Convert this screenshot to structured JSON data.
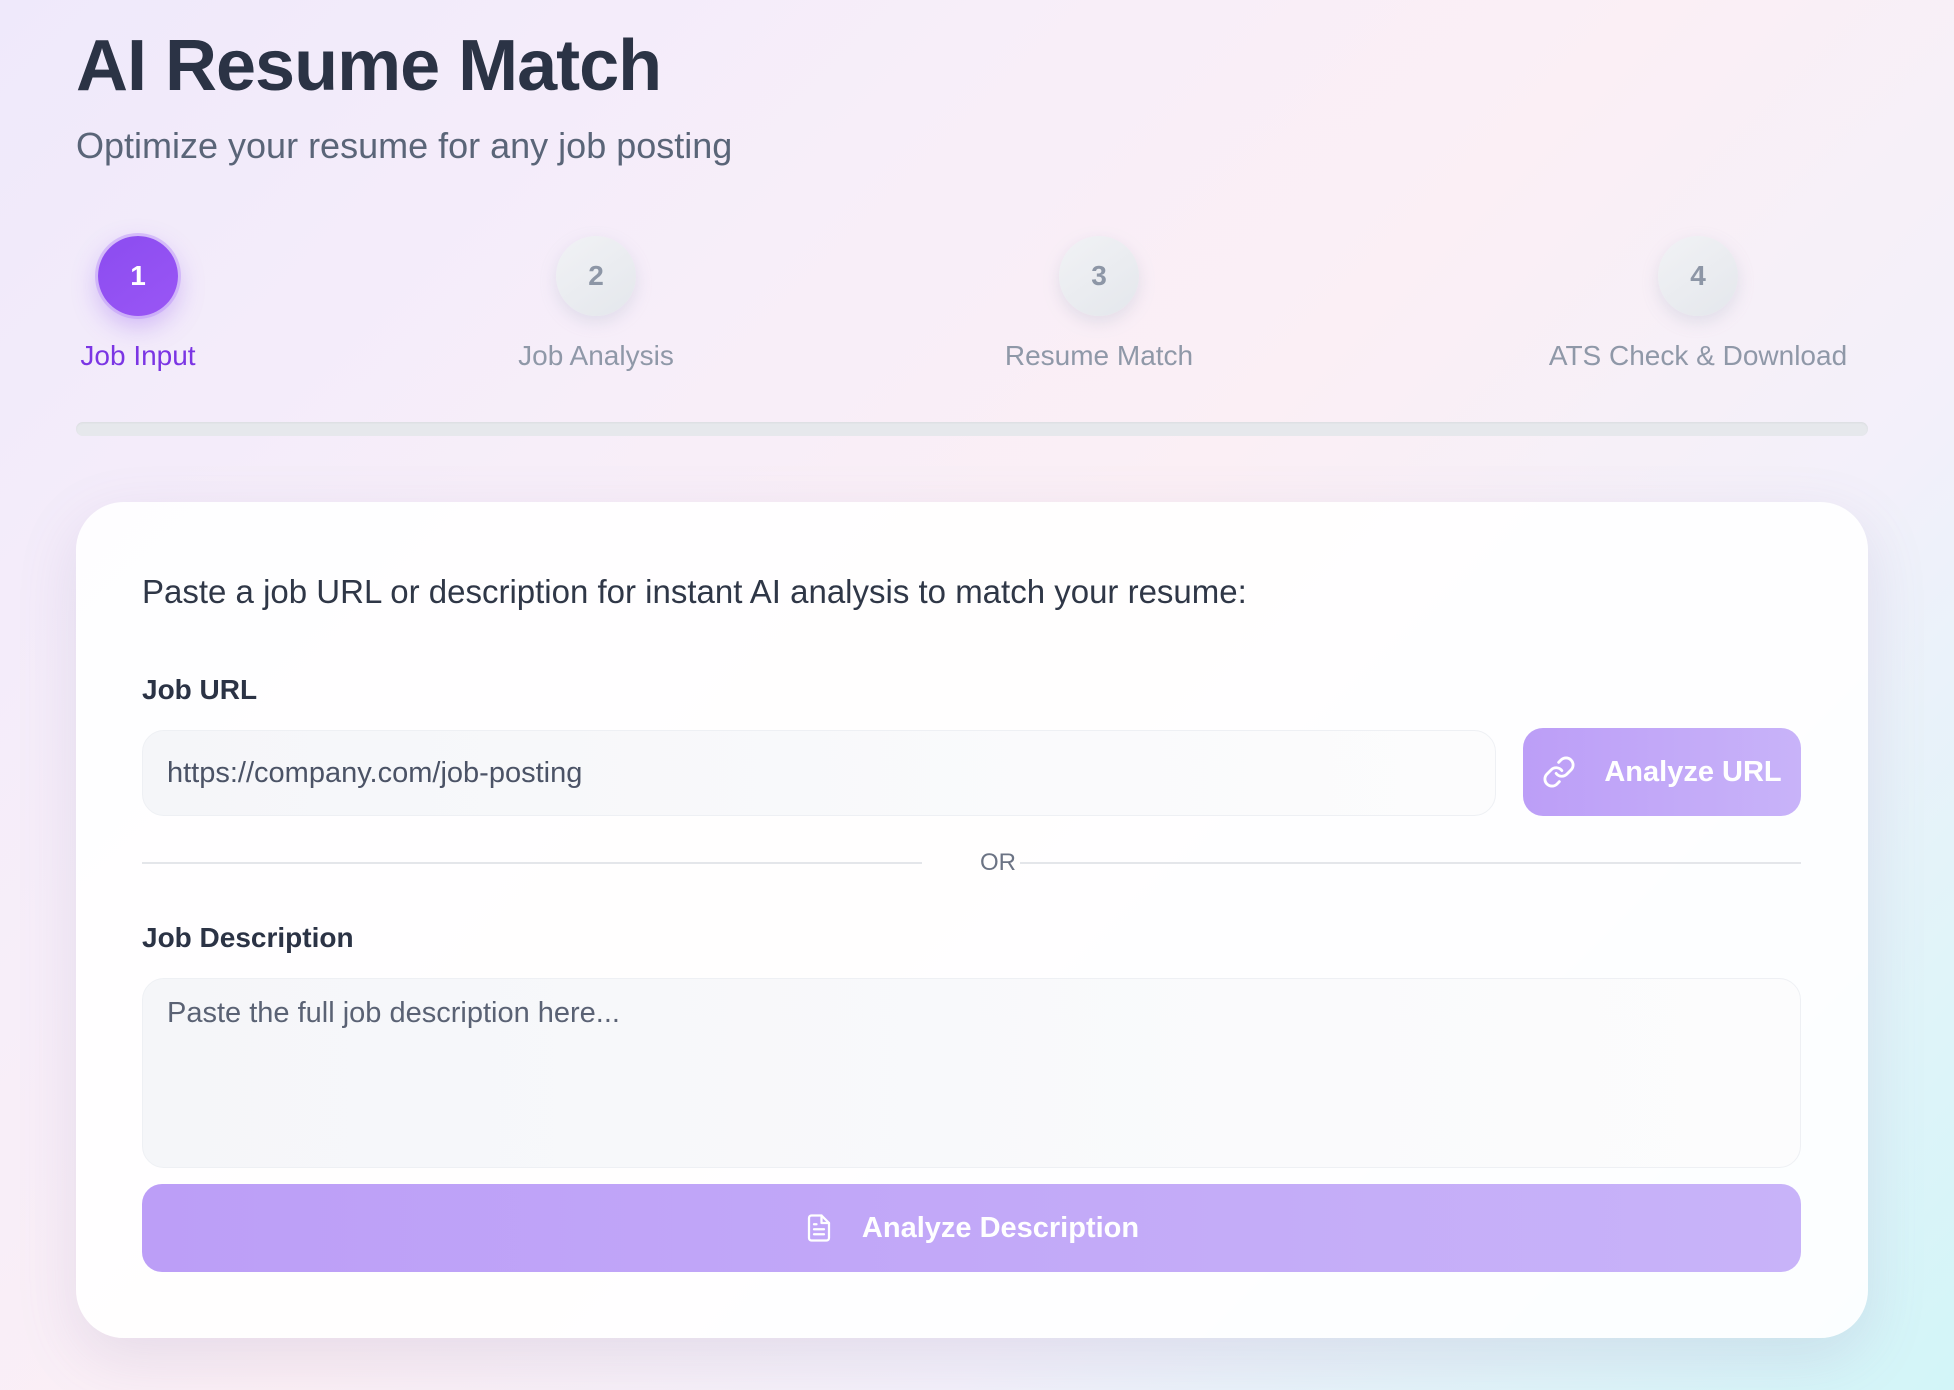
{
  "header": {
    "title": "AI Resume Match",
    "subtitle": "Optimize your resume for any job posting"
  },
  "steps": [
    {
      "number": "1",
      "label": "Job Input",
      "active": true
    },
    {
      "number": "2",
      "label": "Job Analysis",
      "active": false
    },
    {
      "number": "3",
      "label": "Resume Match",
      "active": false
    },
    {
      "number": "4",
      "label": "ATS Check & Download",
      "active": false
    }
  ],
  "progress": {
    "percent": 0
  },
  "form": {
    "intro": "Paste a job URL or description for instant AI analysis to match your resume:",
    "url_label": "Job URL",
    "url_placeholder": "https://company.com/job-posting",
    "url_button": "Analyze URL",
    "url_button_icon": "link-icon",
    "or_text": "OR",
    "desc_label": "Job Description",
    "desc_placeholder": "Paste the full job description here...",
    "desc_button": "Analyze Description",
    "desc_button_icon": "document-icon"
  },
  "colors": {
    "accent": "#9a56f5",
    "accent_text": "#7b35e4",
    "button_bg": "#c0a5f8"
  }
}
